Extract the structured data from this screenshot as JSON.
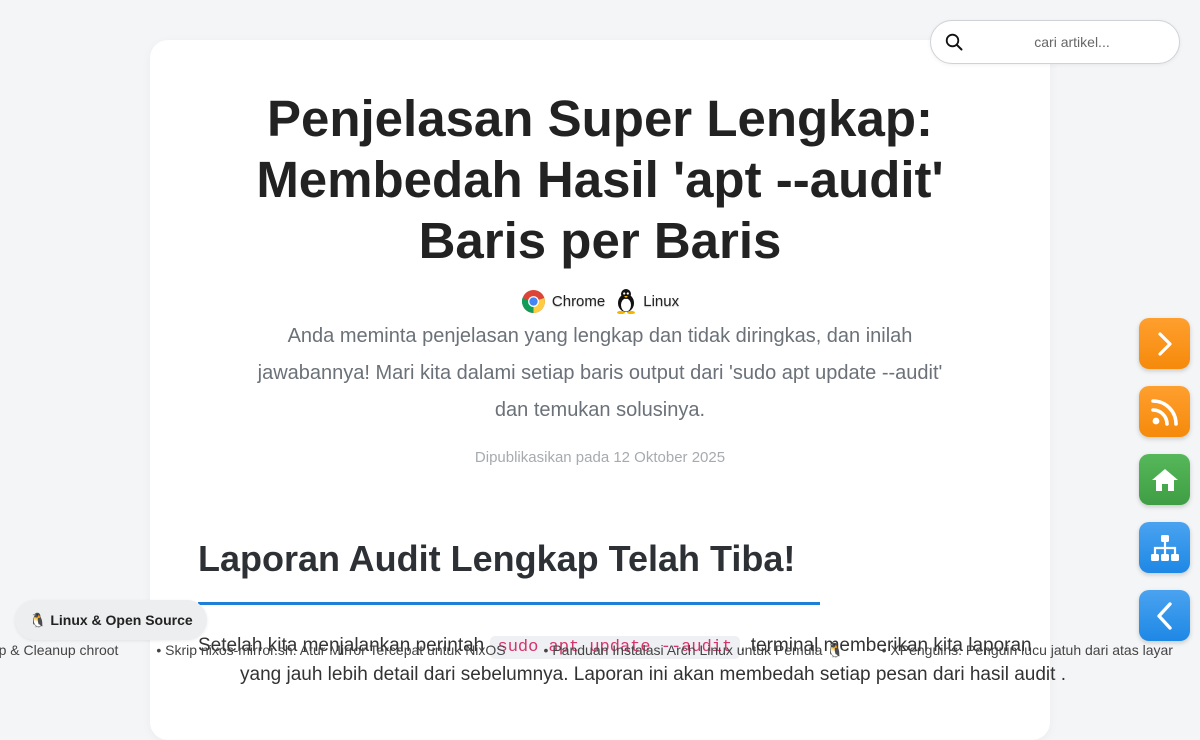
{
  "article": {
    "title_lines": [
      "Penjelasan Super Lengkap:",
      "Membedah Hasil 'apt --audit'",
      "Baris per Baris"
    ],
    "tags": [
      {
        "label": "Chrome",
        "icon": "chrome-icon"
      },
      {
        "label": "Linux",
        "icon": "tux-penguin-icon"
      }
    ],
    "description": "Anda meminta penjelasan yang lengkap dan tidak diringkas, dan inilah jawabannya! Mari kita dalami setiap baris output dari 'sudo apt update --audit' dan temukan solusinya.",
    "published": "Dipublikasikan pada 12 Oktober 2025",
    "section_heading": "Laporan Audit Lengkap Telah Tiba!",
    "paragraph_before_code": "Setelah kita menjalankan perintah",
    "paragraph_code": "sudo apt update --audit",
    "paragraph_after_code": ", terminal memberikan kita laporan",
    "paragraph_next_line": "yang jauh lebih detail dari sebelumnya. Laporan ini akan membedah setiap pesan dari hasil audit ."
  },
  "search": {
    "placeholder": "cari artikel...",
    "value": "",
    "icon": "search-icon"
  },
  "fab_buttons": [
    {
      "name": "next-button",
      "icon": "chevron-right-icon",
      "color": "#f7930f"
    },
    {
      "name": "rss-button",
      "icon": "rss-icon",
      "color": "#f7930f"
    },
    {
      "name": "home-button",
      "icon": "home-icon",
      "color": "#4caf50"
    },
    {
      "name": "sitemap-button",
      "icon": "sitemap-icon",
      "color": "#2196f3"
    },
    {
      "name": "back-button",
      "icon": "chevron-left-icon",
      "color": "#2196f3"
    }
  ],
  "ticker": {
    "badge": "🐧 Linux & Open Source",
    "items": [
      "Skrip Setup & Cleanup chroot",
      "Skrip nixos-mirror.sh: Atur Mirror Tercepat untuk NixOS",
      "Panduan Instalasi Arch Linux untuk Pemula 🐧",
      "XPenguins: Penguin lucu jatuh dari atas layar"
    ]
  },
  "colors": {
    "accent_blue": "#1e7fd6",
    "code_text": "#d6336c",
    "orange": "#f7930f",
    "green": "#4caf50",
    "blue": "#2196f3"
  }
}
